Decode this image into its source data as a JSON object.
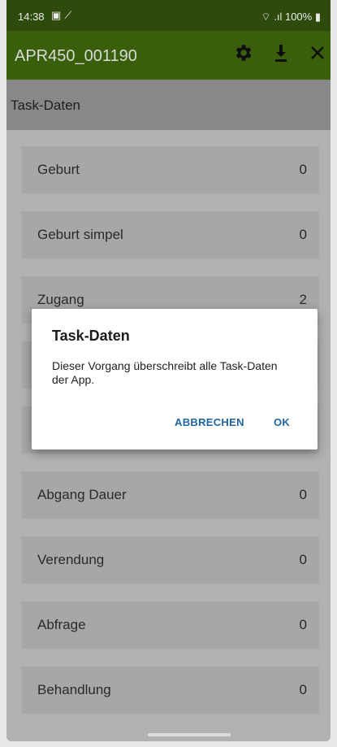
{
  "status_bar": {
    "time": "14:38",
    "left_icons": [
      "photo-icon",
      "tool-icon"
    ],
    "right_text": "100%",
    "right_icons": [
      "wifi-icon",
      "signal-icon",
      "battery-icon"
    ]
  },
  "app_bar": {
    "title": "APR450_001190",
    "actions": [
      "gear-icon",
      "download-icon",
      "close-icon"
    ],
    "color": "#3a5f0b"
  },
  "section_header": "Task-Daten",
  "items": [
    {
      "label": "Geburt",
      "count": "0"
    },
    {
      "label": "Geburt simpel",
      "count": "0"
    },
    {
      "label": "Zugang",
      "count": "2"
    },
    {
      "label": "",
      "count": ""
    },
    {
      "label": "",
      "count": ""
    },
    {
      "label": "Abgang Dauer",
      "count": "0"
    },
    {
      "label": "Verendung",
      "count": "0"
    },
    {
      "label": "Abfrage",
      "count": "0"
    },
    {
      "label": "Behandlung",
      "count": "0"
    }
  ],
  "dialog": {
    "title": "Task-Daten",
    "message": "Dieser Vorgang überschreibt alle Task-Daten der App.",
    "cancel_label": "ABBRECHEN",
    "ok_label": "OK",
    "accent": "#1f65a6"
  }
}
